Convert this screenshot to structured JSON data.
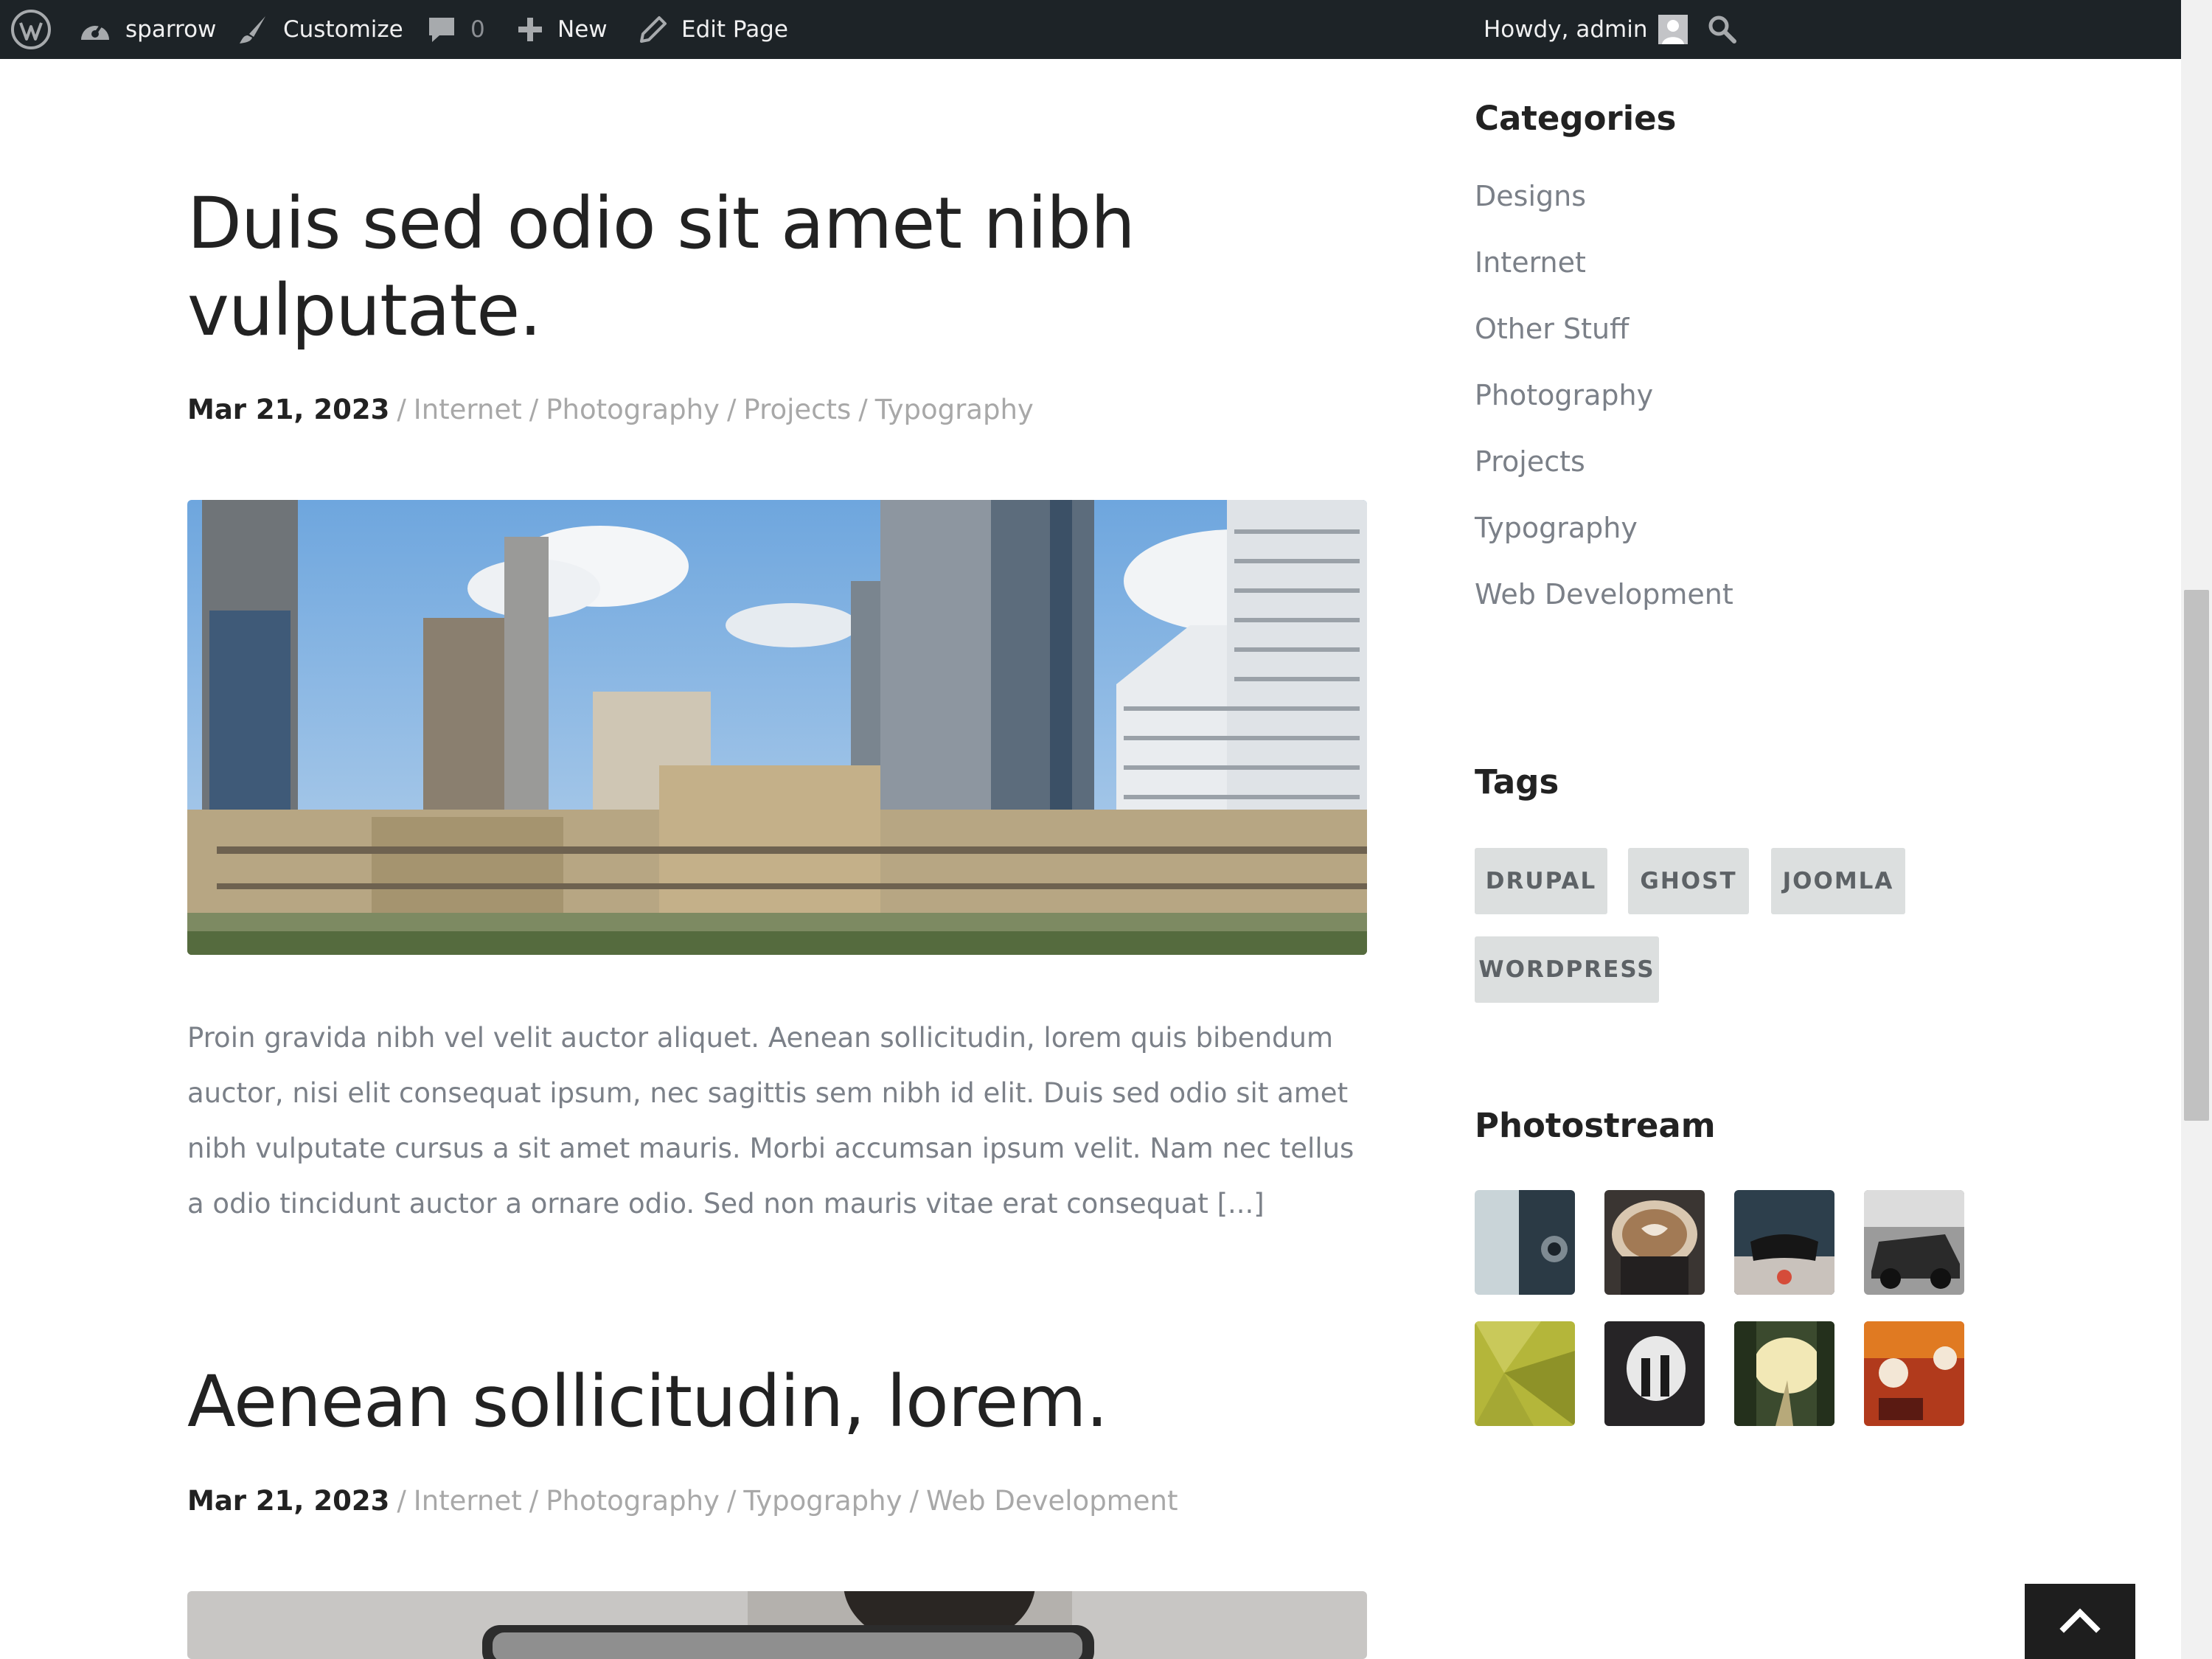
{
  "admin_bar": {
    "site_name": "sparrow",
    "customize": "Customize",
    "comments_count": "0",
    "new": "New",
    "edit_page": "Edit Page",
    "howdy": "Howdy, admin"
  },
  "posts": [
    {
      "title_line1": "Duis sed odio sit amet nibh",
      "title_line2": "vulputate.",
      "date": "Mar 21, 2023",
      "categories": [
        "Internet",
        "Photography",
        "Projects",
        "Typography"
      ],
      "image": "city-skyline-photo",
      "excerpt": "Proin gravida nibh vel velit auctor aliquet. Aenean sollicitudin, lorem quis bibendum auctor, nisi elit consequat ipsum, nec sagittis sem nibh id elit. Duis sed odio sit amet nibh vulputate cursus a sit amet mauris. Morbi accumsan ipsum velit. Nam nec tellus a odio tincidunt auctor a ornare odio. Sed non mauris vitae erat consequat [...]"
    },
    {
      "title": "Aenean sollicitudin, lorem.",
      "date": "Mar 21, 2023",
      "categories": [
        "Internet",
        "Photography",
        "Typography",
        "Web Development"
      ],
      "image": "phone-photo"
    }
  ],
  "sidebar": {
    "categories_title": "Categories",
    "categories": [
      "Designs",
      "Internet",
      "Other Stuff",
      "Photography",
      "Projects",
      "Typography",
      "Web Development"
    ],
    "tags_title": "Tags",
    "tags": [
      "DRUPAL",
      "GHOST",
      "JOOMLA",
      "WORDPRESS"
    ],
    "photostream_title": "Photostream",
    "photos": [
      "camera-photo",
      "coffee-photo",
      "gamepad-photo",
      "vintage-car-photo",
      "green-polygon-photo",
      "cave-silhouette-photo",
      "forest-road-photo",
      "neon-signs-photo"
    ]
  },
  "icons": [
    "wordpress-logo-icon",
    "dashboard-icon",
    "brush-icon",
    "comment-icon",
    "plus-icon",
    "pencil-icon",
    "avatar-icon",
    "search-icon",
    "chevron-up-icon"
  ],
  "colors": {
    "admin_bar": "#1d2327",
    "text_dark": "#222222",
    "text_muted": "#7b8088",
    "link_muted": "#a8a8a8",
    "tag_bg": "#dcdfdf",
    "back_to_top": "#1e1e1e"
  }
}
